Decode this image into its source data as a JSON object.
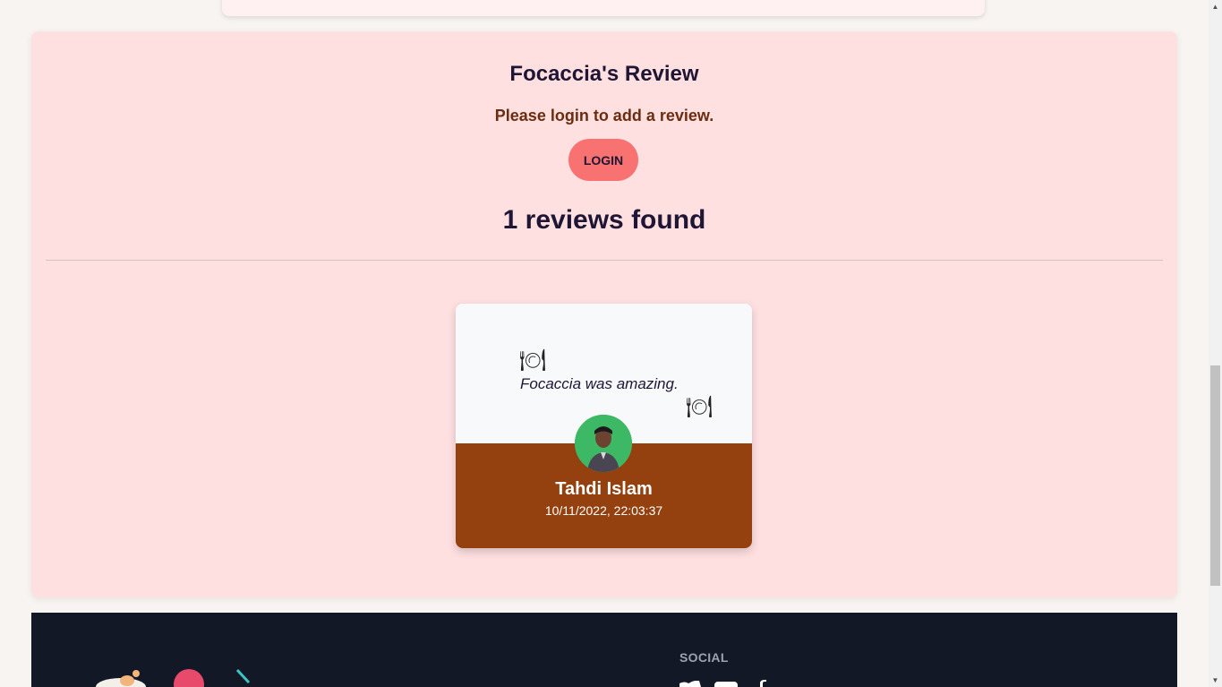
{
  "review_section": {
    "title": "Focaccia's Review",
    "login_message": "Please login to add a review.",
    "login_button": "LOGIN",
    "count_text": "1 reviews found"
  },
  "reviews": [
    {
      "text": "Focaccia was amazing.",
      "reviewer": "Tahdi Islam",
      "date": "10/11/2022, 22:03:37",
      "quote_icon": "plate-cutlery-icon"
    }
  ],
  "footer": {
    "social_label": "SOCIAL",
    "icons": [
      "twitter-icon",
      "youtube-icon",
      "facebook-icon"
    ]
  },
  "colors": {
    "section_bg": "#ffe0e1",
    "accent_button": "#f87272",
    "card_bottom": "#94410f",
    "footer_bg": "#121826"
  }
}
